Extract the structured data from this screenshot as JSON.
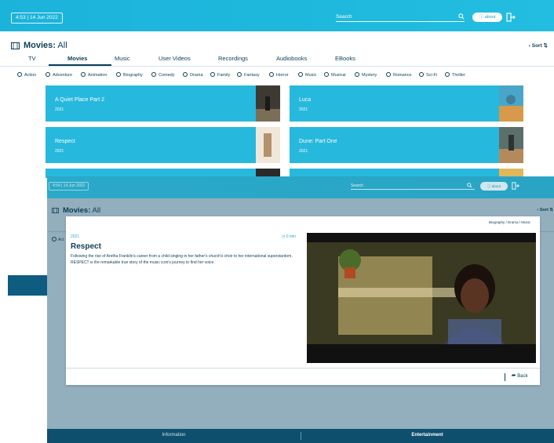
{
  "back_window": {
    "datetime": "4:53 | 14 Jun 2022",
    "search_label": "Search",
    "about_label": "about",
    "page_title_prefix": "Movies:",
    "page_title_filter": "All",
    "sort_label": "Sort",
    "tabs": [
      "TV",
      "Movies",
      "Music",
      "User Videos",
      "Recordings",
      "Audiobooks",
      "EBooks"
    ],
    "active_tab": "Movies",
    "genres": [
      "Action",
      "Adventure",
      "Animation",
      "Biography",
      "Comedy",
      "Drama",
      "Family",
      "Fantasy",
      "Horror",
      "Music",
      "Musical",
      "Mystery",
      "Romance",
      "Sci-Fi",
      "Thriller"
    ],
    "movies": [
      {
        "title": "A Quiet Place Part 2",
        "year": "2021"
      },
      {
        "title": "Luca",
        "year": "2021"
      },
      {
        "title": "Respect",
        "year": "2021"
      },
      {
        "title": "Dune: Part One",
        "year": "2021"
      }
    ]
  },
  "front_window": {
    "datetime": "4:54 | 14 Jun 2022",
    "search_label": "Search",
    "about_label": "about",
    "page_title_prefix": "Movies:",
    "page_title_filter": "All",
    "sort_label": "Sort",
    "genre_partial": "Act",
    "detail": {
      "genres": "Biography / Drama / Music",
      "year": "2021",
      "duration": "0 min",
      "title": "Respect",
      "description": "Following the rise of Aretha Franklin's career from a child singing in her father's church's choir to her international superstardom, RESPECT is the remarkable true story of the music icon's journey to find her voice.",
      "back_label": "Back"
    },
    "bottom_tabs": {
      "information": "Information",
      "entertainment": "Entertainment"
    }
  },
  "colors": {
    "accent": "#27b8dd",
    "dark": "#0b3d54",
    "bottom_bar": "#0f4f6e"
  }
}
